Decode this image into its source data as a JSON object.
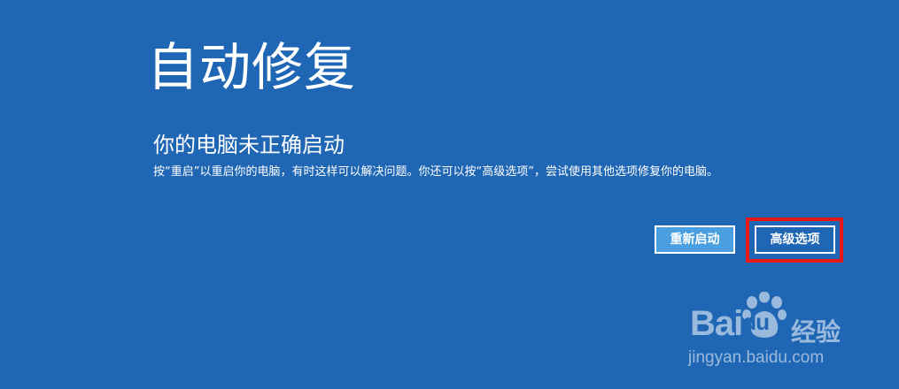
{
  "screen": {
    "title": "自动修复",
    "subtitle": "你的电脑未正确启动",
    "description": "按“重启”以重启你的电脑，有时这样可以解决问题。你还可以按“高级选项”，尝试使用其他选项修复你的电脑。"
  },
  "buttons": {
    "restart_label": "重新启动",
    "advanced_label": "高级选项"
  },
  "watermark": {
    "brand_left": "Bai",
    "brand_right": "du",
    "suffix": "经验",
    "url": "jingyan.baidu.com"
  },
  "colors": {
    "background": "#1f66b4",
    "restart_button": "#4a9fe0",
    "highlight": "#e81717"
  }
}
